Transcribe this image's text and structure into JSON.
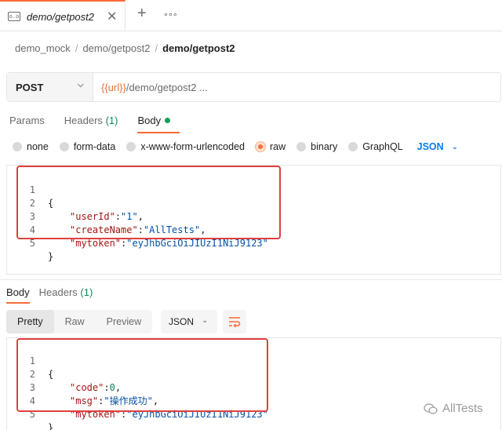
{
  "tab": {
    "icon_text": "o.o",
    "title": "demo/getpost2",
    "close": "✕",
    "new_tab": "+",
    "more": "∘∘∘"
  },
  "breadcrumb": {
    "items": [
      "demo_mock",
      "demo/getpost2"
    ],
    "separator": "/",
    "current": "demo/getpost2"
  },
  "request": {
    "method": "POST",
    "url_variable": "{{url}}",
    "url_path": "/demo/getpost2 ..."
  },
  "request_tabs": {
    "params": "Params",
    "headers": "Headers",
    "headers_count": "(1)",
    "body": "Body"
  },
  "body_types": {
    "options": [
      "none",
      "form-data",
      "x-www-form-urlencoded",
      "raw",
      "binary",
      "GraphQL"
    ],
    "selected": "raw",
    "language": "JSON"
  },
  "request_body": {
    "lines": [
      {
        "n": "1",
        "text": "{"
      },
      {
        "n": "2",
        "key": "\"userId\"",
        "sep": ":",
        "value": "\"1\"",
        "end": ","
      },
      {
        "n": "3",
        "key": "\"createName\"",
        "sep": ":",
        "value": "\"AllTests\"",
        "end": ","
      },
      {
        "n": "4",
        "key": "\"mytoken\"",
        "sep": ":",
        "value": "\"eyJhbGciOiJIUzI1NiJ9123\"",
        "end": ""
      },
      {
        "n": "5",
        "text": "}"
      }
    ]
  },
  "response_tabs": {
    "body": "Body",
    "headers": "Headers",
    "headers_count": "(1)"
  },
  "response_view": {
    "pretty": "Pretty",
    "raw": "Raw",
    "preview": "Preview",
    "format": "JSON"
  },
  "response_body": {
    "lines": [
      {
        "n": "1",
        "text": "{"
      },
      {
        "n": "2",
        "key": "\"code\"",
        "sep": ":",
        "value": "0",
        "end": ","
      },
      {
        "n": "3",
        "key": "\"msg\"",
        "sep": ":",
        "value": "\"操作成功\"",
        "end": ","
      },
      {
        "n": "4",
        "key": "\"mytoken\"",
        "sep": ":",
        "value": "\"eyJhbGciOiJIUzI1NiJ9123\"",
        "end": ""
      },
      {
        "n": "5",
        "text": "}"
      }
    ]
  },
  "watermark": {
    "text": "AllTests"
  },
  "colors": {
    "accent": "#ff6c37",
    "highlight_box": "#e0403f",
    "json_key": "#a31515",
    "json_string": "#0451a5",
    "json_number": "#098658",
    "link_blue": "#097bed",
    "count_green": "#0f8a5f"
  }
}
